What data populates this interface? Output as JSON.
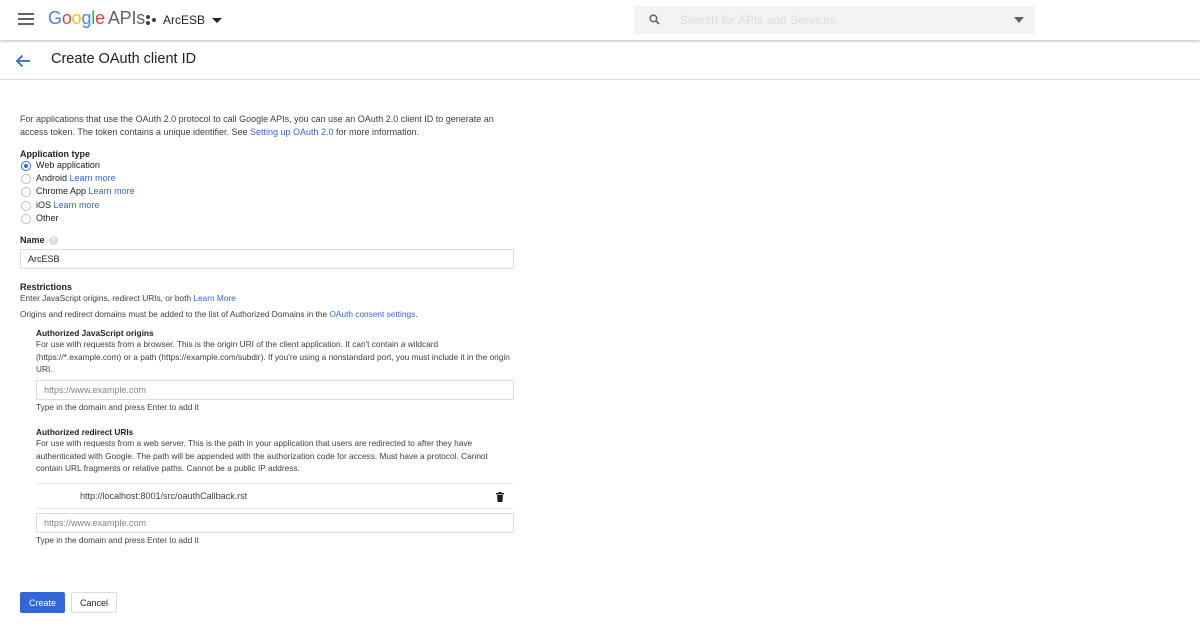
{
  "header": {
    "logo_text": "Google",
    "logo_suffix": "APIs",
    "project_name": "ArcESB",
    "search_placeholder": "Search for APIs and Services"
  },
  "page": {
    "title": "Create OAuth client ID"
  },
  "intro": {
    "text_before_link": "For applications that use the OAuth 2.0 protocol to call Google APIs, you can use an OAuth 2.0 client ID to generate an access token. The token contains a unique identifier. See ",
    "link_text": "Setting up OAuth 2.0",
    "text_after_link": " for more information."
  },
  "application_type": {
    "label": "Application type",
    "selected": "Web application",
    "options": [
      {
        "label": "Web application",
        "link": ""
      },
      {
        "label": "Android",
        "link": "Learn more"
      },
      {
        "label": "Chrome App",
        "link": "Learn more"
      },
      {
        "label": "iOS",
        "link": "Learn more"
      },
      {
        "label": "Other",
        "link": ""
      }
    ]
  },
  "name_field": {
    "label": "Name",
    "value": "ArcESB"
  },
  "restrictions": {
    "label": "Restrictions",
    "line1_text": "Enter JavaScript origins, redirect URIs, or both ",
    "line1_link": "Learn More",
    "line2_text": "Origins and redirect domains must be added to the list of Authorized Domains in the ",
    "line2_link": "OAuth consent settings",
    "line2_end": ".",
    "js_origins": {
      "label": "Authorized JavaScript origins",
      "description": "For use with requests from a browser. This is the origin URI of the client application. It can't contain a wildcard (https://*.example.com) or a path (https://example.com/subdir). If you're using a nonstandard port, you must include it in the origin URI.",
      "placeholder": "https://www.example.com",
      "hint": "Type in the domain and press Enter to add it"
    },
    "redirect_uris": {
      "label": "Authorized redirect URIs",
      "description": "For use with requests from a web server. This is the path in your application that users are redirected to after they have authenticated with Google. The path will be appended with the authorization code for access. Must have a protocol. Cannot contain URL fragments or relative paths. Cannot be a public IP address.",
      "entries": [
        "http://localhost:8001/src/oauthCallback.rst"
      ],
      "placeholder": "https://www.example.com",
      "hint": "Type in the domain and press Enter to add it"
    }
  },
  "actions": {
    "create_label": "Create",
    "cancel_label": "Cancel"
  },
  "colors": {
    "accent": "#3367d6",
    "google_blue": "#4285f4",
    "google_red": "#ea4335",
    "google_yellow": "#fbbc05",
    "google_green": "#34a853"
  }
}
